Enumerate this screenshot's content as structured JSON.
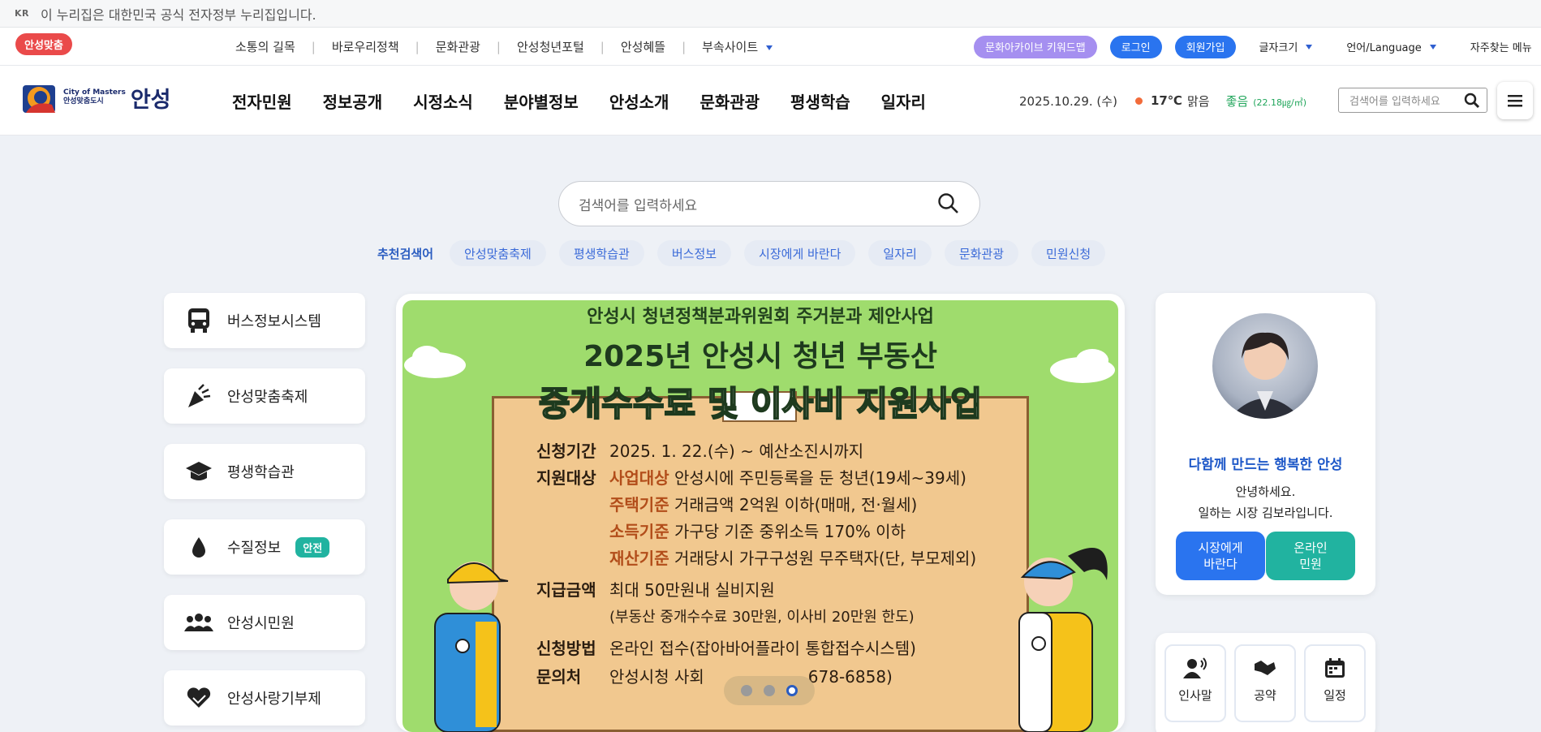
{
  "gov_banner": {
    "lang": "KR",
    "text": "이 누리집은 대한민국 공식 전자정부 누리집입니다."
  },
  "util": {
    "badge": "안성맞춤",
    "links": [
      "소통의 길목",
      "바로우리정책",
      "문화관광",
      "안성청년포털",
      "안성혜뜰",
      "부속사이트"
    ],
    "archive_label": "문화아카이브 키워드맵",
    "login_label": "로그인",
    "join_label": "회원가입",
    "font_size_label": "글자크기",
    "language_label": "언어/Language",
    "faq_menu_label": "자주찾는 메뉴"
  },
  "header": {
    "logo_small_1": "City of Masters",
    "logo_small_2": "안성맞춤도시",
    "logo_big": "안성",
    "nav": [
      "전자민원",
      "정보공개",
      "시정소식",
      "분야별정보",
      "안성소개",
      "문화관광",
      "평생학습",
      "일자리"
    ],
    "date": "2025.10.29. (수)",
    "temp": "17℃",
    "weather": "맑음",
    "air": "좋음",
    "air_value": "(22.18㎍/㎥)",
    "search_placeholder": "검색어를 입력하세요"
  },
  "main_search": {
    "placeholder": "검색어를 입력하세요",
    "reco_label": "추천검색어",
    "keywords": [
      "안성맞춤축제",
      "평생학습관",
      "버스정보",
      "시장에게 바란다",
      "일자리",
      "문화관광",
      "민원신청"
    ]
  },
  "quick": [
    {
      "label": "버스정보시스템",
      "icon": "bus-icon"
    },
    {
      "label": "안성맞춤축제",
      "icon": "party-popper-icon"
    },
    {
      "label": "평생학습관",
      "icon": "graduation-cap-icon"
    },
    {
      "label": "수질정보",
      "icon": "water-drop-icon",
      "badge": "안전"
    },
    {
      "label": "안성시민원",
      "icon": "people-group-icon"
    },
    {
      "label": "안성사랑기부제",
      "icon": "heart-hands-icon"
    }
  ],
  "banner": {
    "top": "안성시 청년정책분과위원회 주거분과 제안사업",
    "title1": "2025년 안성시 청년 부동산",
    "title2": "중개수수료 및 이사비 지원사업",
    "period_k": "신청기간",
    "period_v": "2025. 1. 22.(수) ~ 예산소진시까지",
    "target_k": "지원대상",
    "t1_o": "사업대상",
    "t1_v": "안성시에 주민등록을 둔 청년(19세~39세)",
    "t2_o": "주택기준",
    "t2_v": "거래금액 2억원 이하(매매, 전·월세)",
    "t3_o": "소득기준",
    "t3_v": "가구당 기준 중위소득 170% 이하",
    "t4_o": "재산기준",
    "t4_v": "거래당시 가구구성원 무주택자(단, 부모제외)",
    "amount_k": "지급금액",
    "amount_v": "최대 50만원내 실비지원",
    "amount_v2": "(부동산 중개수수료 30만원, 이사비 20만원 한도)",
    "method_k": "신청방법",
    "method_v": "온라인 접수(잡아바어플라이 통합접수시스템)",
    "contact_k": "문의처",
    "contact_v1": "안성시청 사회",
    "contact_v2": "678-6858)",
    "slide_current": 3,
    "slide_total": 3
  },
  "mayor": {
    "tagline": "다함께 만드는 행복한 안성",
    "greet1": "안녕하세요.",
    "greet2": "일하는 시장 김보라입니다.",
    "btn1_a": "시장에게",
    "btn1_b": "바란다",
    "btn2_a": "온라인",
    "btn2_b": "민원",
    "links": [
      "인사말",
      "공약",
      "일정"
    ]
  },
  "colors": {
    "accent": "#2a74ef",
    "teal": "#21b3a0",
    "red_badge": "#ea4a4a",
    "purple": "#a58ff0"
  }
}
